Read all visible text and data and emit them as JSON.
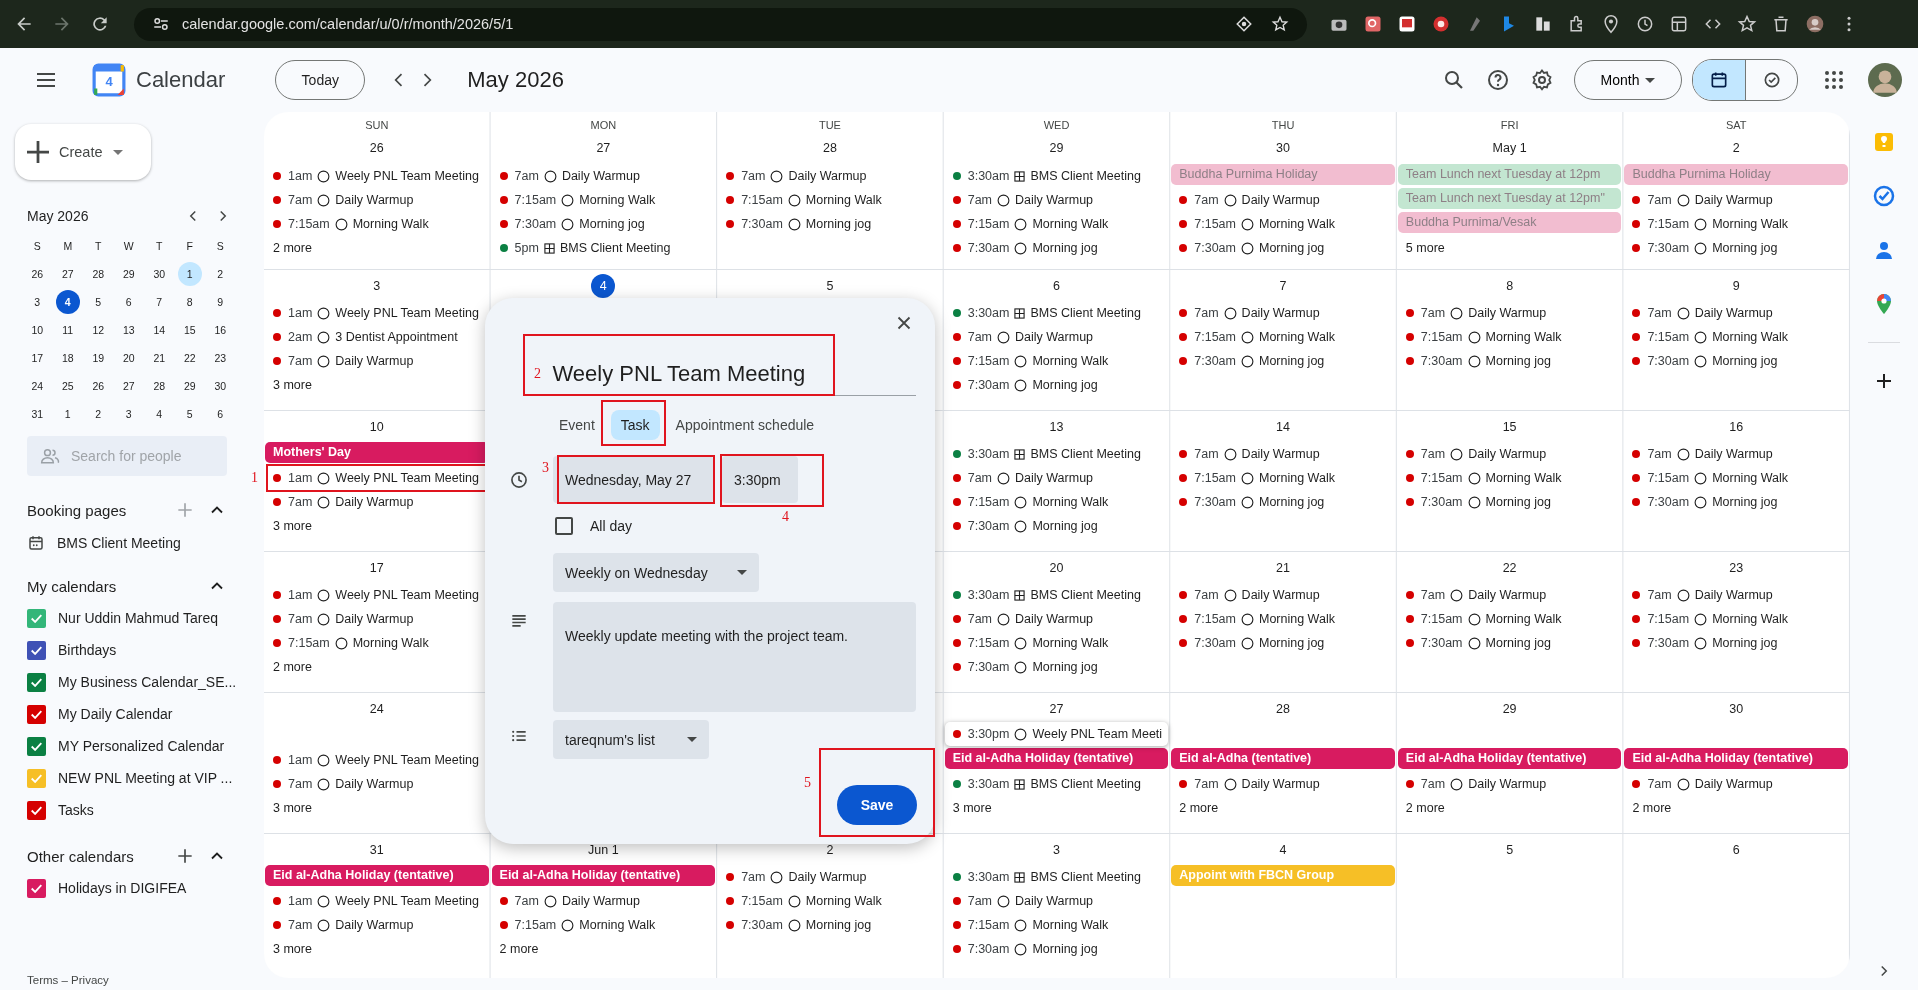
{
  "browser": {
    "url": "calendar.google.com/calendar/u/0/r/month/2026/5/1"
  },
  "header": {
    "logo_day": "4",
    "app_name": "Calendar",
    "today_button": "Today",
    "period": "May 2026",
    "view_select": "Month",
    "view_toggle": [
      {
        "kind": "calendar",
        "selected": true
      },
      {
        "kind": "tasks",
        "selected": false
      }
    ]
  },
  "sidebar": {
    "create_button": "Create",
    "mini_calendar": {
      "title": "May 2026",
      "weekdays": [
        "S",
        "M",
        "T",
        "W",
        "T",
        "F",
        "S"
      ],
      "weeks": [
        [
          {
            "d": "26",
            "selected": false
          },
          {
            "d": "27",
            "selected": false
          },
          {
            "d": "28",
            "selected": false
          },
          {
            "d": "29",
            "selected": false
          },
          {
            "d": "30",
            "selected": false
          },
          {
            "d": "1",
            "selected": true
          },
          {
            "d": "2",
            "selected": false
          }
        ],
        [
          {
            "d": "3",
            "selected": false
          },
          {
            "d": "4",
            "selected": false,
            "today": true
          },
          {
            "d": "5",
            "selected": false
          },
          {
            "d": "6",
            "selected": false
          },
          {
            "d": "7",
            "selected": false
          },
          {
            "d": "8",
            "selected": false
          },
          {
            "d": "9",
            "selected": false
          }
        ],
        [
          {
            "d": "10",
            "selected": false
          },
          {
            "d": "11",
            "selected": false
          },
          {
            "d": "12",
            "selected": false
          },
          {
            "d": "13",
            "selected": false
          },
          {
            "d": "14",
            "selected": false
          },
          {
            "d": "15",
            "selected": false
          },
          {
            "d": "16",
            "selected": false
          }
        ],
        [
          {
            "d": "17",
            "selected": false
          },
          {
            "d": "18",
            "selected": false
          },
          {
            "d": "19",
            "selected": false
          },
          {
            "d": "20",
            "selected": false
          },
          {
            "d": "21",
            "selected": false
          },
          {
            "d": "22",
            "selected": false
          },
          {
            "d": "23",
            "selected": false
          }
        ],
        [
          {
            "d": "24",
            "selected": false
          },
          {
            "d": "25",
            "selected": false
          },
          {
            "d": "26",
            "selected": false
          },
          {
            "d": "27",
            "selected": false
          },
          {
            "d": "28",
            "selected": false
          },
          {
            "d": "29",
            "selected": false
          },
          {
            "d": "30",
            "selected": false
          }
        ],
        [
          {
            "d": "31",
            "selected": false
          },
          {
            "d": "1",
            "selected": false
          },
          {
            "d": "2",
            "selected": false
          },
          {
            "d": "3",
            "selected": false
          },
          {
            "d": "4",
            "selected": false
          },
          {
            "d": "5",
            "selected": false
          },
          {
            "d": "6",
            "selected": false
          }
        ]
      ]
    },
    "search": {
      "placeholder": "Search for people"
    },
    "booking_pages": {
      "title": "Booking pages",
      "items": [
        "BMS Client Meeting"
      ]
    },
    "my_calendars": {
      "title": "My calendars",
      "items": [
        {
          "label": "Nur Uddin Mahmud Tareq",
          "checked": true,
          "color": "#33b679"
        },
        {
          "label": "Birthdays",
          "checked": true,
          "color": "#3f51b5"
        },
        {
          "label": "My Business Calendar_SE...",
          "checked": true,
          "color": "#0b8043"
        },
        {
          "label": "My Daily Calendar",
          "checked": true,
          "color": "#d50000"
        },
        {
          "label": "MY Personalized Calendar",
          "checked": true,
          "color": "#0b8043"
        },
        {
          "label": "NEW PNL Meeting at VIP ...",
          "checked": true,
          "color": "#f6bf26"
        },
        {
          "label": "Tasks",
          "checked": true,
          "color": "#d50000"
        }
      ]
    },
    "other_calendars": {
      "title": "Other calendars",
      "items": [
        {
          "label": "Holidays in DIGIFEA",
          "checked": true,
          "color": "#d81b60"
        }
      ]
    },
    "footer": "Terms – Privacy"
  },
  "month": {
    "weekdays": [
      "SUN",
      "MON",
      "TUE",
      "WED",
      "THU",
      "FRI",
      "SAT"
    ],
    "weeks": [
      {
        "days": [
          {
            "date": "26",
            "events": [
              {
                "kind": "task",
                "time": "1am",
                "title": "Weely PNL Team Meeting",
                "color": "#d50000"
              },
              {
                "kind": "task",
                "time": "7am",
                "title": "Daily Warmup",
                "color": "#d50000"
              },
              {
                "kind": "task",
                "time": "7:15am",
                "title": "Morning Walk",
                "color": "#d50000"
              }
            ],
            "more": "2 more"
          },
          {
            "date": "27",
            "events": [
              {
                "kind": "task",
                "time": "7am",
                "title": "Daily Warmup",
                "color": "#d50000"
              },
              {
                "kind": "task",
                "time": "7:15am",
                "title": "Morning Walk",
                "color": "#d50000"
              },
              {
                "kind": "task",
                "time": "7:30am",
                "title": "Morning jog",
                "color": "#d50000"
              },
              {
                "kind": "booking",
                "time": "5pm",
                "title": "BMS Client Meeting",
                "color": "#0b8043"
              }
            ]
          },
          {
            "date": "28",
            "events": [
              {
                "kind": "task",
                "time": "7am",
                "title": "Daily Warmup",
                "color": "#d50000"
              },
              {
                "kind": "task",
                "time": "7:15am",
                "title": "Morning Walk",
                "color": "#d50000"
              },
              {
                "kind": "task",
                "time": "7:30am",
                "title": "Morning jog",
                "color": "#d50000"
              }
            ]
          },
          {
            "date": "29",
            "events": [
              {
                "kind": "booking",
                "time": "3:30am",
                "title": "BMS Client Meeting",
                "color": "#0b8043"
              },
              {
                "kind": "task",
                "time": "7am",
                "title": "Daily Warmup",
                "color": "#d50000"
              },
              {
                "kind": "task",
                "time": "7:15am",
                "title": "Morning Walk",
                "color": "#d50000"
              },
              {
                "kind": "task",
                "time": "7:30am",
                "title": "Morning jog",
                "color": "#d50000"
              }
            ]
          },
          {
            "date": "30",
            "events": [
              {
                "kind": "allday",
                "title": "Buddha Purnima Holiday",
                "color": "#f2bdd0",
                "muted": true
              },
              {
                "kind": "task",
                "time": "7am",
                "title": "Daily Warmup",
                "color": "#d50000"
              },
              {
                "kind": "task",
                "time": "7:15am",
                "title": "Morning Walk",
                "color": "#d50000"
              },
              {
                "kind": "task",
                "time": "7:30am",
                "title": "Morning jog",
                "color": "#d50000"
              }
            ]
          },
          {
            "date": "May 1",
            "events": [
              {
                "kind": "allday",
                "title": "Team Lunch next Tuesday at 12pm",
                "color": "#c3e6d1",
                "muted": true
              },
              {
                "kind": "allday",
                "title": "Team Lunch next Tuesday at 12pm\"",
                "color": "#c3e6d1",
                "muted": true
              },
              {
                "kind": "allday",
                "title": "Buddha Purnima/Vesak",
                "color": "#f2bdd0",
                "muted": true
              }
            ],
            "more": "5 more"
          },
          {
            "date": "2",
            "events": [
              {
                "kind": "allday",
                "title": "Buddha Purnima Holiday",
                "color": "#f2bdd0",
                "muted": true
              },
              {
                "kind": "task",
                "time": "7am",
                "title": "Daily Warmup",
                "color": "#d50000"
              },
              {
                "kind": "task",
                "time": "7:15am",
                "title": "Morning Walk",
                "color": "#d50000"
              },
              {
                "kind": "task",
                "time": "7:30am",
                "title": "Morning jog",
                "color": "#d50000"
              }
            ]
          }
        ]
      },
      {
        "days": [
          {
            "date": "3",
            "events": [
              {
                "kind": "task",
                "time": "1am",
                "title": "Weely PNL Team Meeting",
                "color": "#d50000"
              },
              {
                "kind": "task",
                "time": "2am",
                "title": "3 Dentist Appointment",
                "color": "#d50000"
              },
              {
                "kind": "task",
                "time": "7am",
                "title": "Daily Warmup",
                "color": "#d50000"
              }
            ],
            "more": "3 more"
          },
          {
            "date": "4",
            "today": true
          },
          {
            "date": "5"
          },
          {
            "date": "6",
            "events": [
              {
                "kind": "booking",
                "time": "3:30am",
                "title": "BMS Client Meeting",
                "color": "#0b8043"
              },
              {
                "kind": "task",
                "time": "7am",
                "title": "Daily Warmup",
                "color": "#d50000"
              },
              {
                "kind": "task",
                "time": "7:15am",
                "title": "Morning Walk",
                "color": "#d50000"
              },
              {
                "kind": "task",
                "time": "7:30am",
                "title": "Morning jog",
                "color": "#d50000"
              }
            ]
          },
          {
            "date": "7",
            "events": [
              {
                "kind": "task",
                "time": "7am",
                "title": "Daily Warmup",
                "color": "#d50000"
              },
              {
                "kind": "task",
                "time": "7:15am",
                "title": "Morning Walk",
                "color": "#d50000"
              },
              {
                "kind": "task",
                "time": "7:30am",
                "title": "Morning jog",
                "color": "#d50000"
              }
            ]
          },
          {
            "date": "8",
            "events": [
              {
                "kind": "task",
                "time": "7am",
                "title": "Daily Warmup",
                "color": "#d50000"
              },
              {
                "kind": "task",
                "time": "7:15am",
                "title": "Morning Walk",
                "color": "#d50000"
              },
              {
                "kind": "task",
                "time": "7:30am",
                "title": "Morning jog",
                "color": "#d50000"
              }
            ]
          },
          {
            "date": "9",
            "events": [
              {
                "kind": "task",
                "time": "7am",
                "title": "Daily Warmup",
                "color": "#d50000"
              },
              {
                "kind": "task",
                "time": "7:15am",
                "title": "Morning Walk",
                "color": "#d50000"
              },
              {
                "kind": "task",
                "time": "7:30am",
                "title": "Morning jog",
                "color": "#d50000"
              }
            ]
          }
        ]
      },
      {
        "days": [
          {
            "date": "10",
            "events": [
              {
                "kind": "allday",
                "title": "Mothers' Day",
                "color": "#d81b60",
                "muted": false
              },
              {
                "kind": "task",
                "time": "1am",
                "title": "Weely PNL Team Meeting",
                "color": "#d50000",
                "highlighted": true,
                "callout_number": "1"
              },
              {
                "kind": "task",
                "time": "7am",
                "title": "Daily Warmup",
                "color": "#d50000"
              }
            ],
            "more": "3 more"
          },
          {
            "date": "13",
            "events": [
              {
                "kind": "booking",
                "time": "3:30am",
                "title": "BMS Client Meeting",
                "color": "#0b8043"
              },
              {
                "kind": "task",
                "time": "7am",
                "title": "Daily Warmup",
                "color": "#d50000"
              },
              {
                "kind": "task",
                "time": "7:15am",
                "title": "Morning Walk",
                "color": "#d50000"
              },
              {
                "kind": "task",
                "time": "7:30am",
                "title": "Morning jog",
                "color": "#d50000"
              }
            ]
          },
          {
            "date": "14",
            "events": [
              {
                "kind": "task",
                "time": "7am",
                "title": "Daily Warmup",
                "color": "#d50000"
              },
              {
                "kind": "task",
                "time": "7:15am",
                "title": "Morning Walk",
                "color": "#d50000"
              },
              {
                "kind": "task",
                "time": "7:30am",
                "title": "Morning jog",
                "color": "#d50000"
              }
            ]
          },
          {
            "date": "15",
            "events": [
              {
                "kind": "task",
                "time": "7am",
                "title": "Daily Warmup",
                "color": "#d50000"
              },
              {
                "kind": "task",
                "time": "7:15am",
                "title": "Morning Walk",
                "color": "#d50000"
              },
              {
                "kind": "task",
                "time": "7:30am",
                "title": "Morning jog",
                "color": "#d50000"
              }
            ]
          },
          {
            "date": "16",
            "events": [
              {
                "kind": "task",
                "time": "7am",
                "title": "Daily Warmup",
                "color": "#d50000"
              },
              {
                "kind": "task",
                "time": "7:15am",
                "title": "Morning Walk",
                "color": "#d50000"
              },
              {
                "kind": "task",
                "time": "7:30am",
                "title": "Morning jog",
                "color": "#d50000"
              }
            ]
          }
        ]
      },
      {
        "days": [
          {
            "date": "17",
            "events": [
              {
                "kind": "task",
                "time": "1am",
                "title": "Weely PNL Team Meeting",
                "color": "#d50000"
              },
              {
                "kind": "task",
                "time": "7am",
                "title": "Daily Warmup",
                "color": "#d50000"
              },
              {
                "kind": "task",
                "time": "7:15am",
                "title": "Morning Walk",
                "color": "#d50000"
              }
            ],
            "more": "2 more"
          },
          {
            "date": "20",
            "events": [
              {
                "kind": "booking",
                "time": "3:30am",
                "title": "BMS Client Meeting",
                "color": "#0b8043"
              },
              {
                "kind": "task",
                "time": "7am",
                "title": "Daily Warmup",
                "color": "#d50000"
              },
              {
                "kind": "task",
                "time": "7:15am",
                "title": "Morning Walk",
                "color": "#d50000"
              },
              {
                "kind": "task",
                "time": "7:30am",
                "title": "Morning jog",
                "color": "#d50000"
              }
            ]
          },
          {
            "date": "21",
            "events": [
              {
                "kind": "task",
                "time": "7am",
                "title": "Daily Warmup",
                "color": "#d50000"
              },
              {
                "kind": "task",
                "time": "7:15am",
                "title": "Morning Walk",
                "color": "#d50000"
              },
              {
                "kind": "task",
                "time": "7:30am",
                "title": "Morning jog",
                "color": "#d50000"
              }
            ]
          },
          {
            "date": "22",
            "events": [
              {
                "kind": "task",
                "time": "7am",
                "title": "Daily Warmup",
                "color": "#d50000"
              },
              {
                "kind": "task",
                "time": "7:15am",
                "title": "Morning Walk",
                "color": "#d50000"
              },
              {
                "kind": "task",
                "time": "7:30am",
                "title": "Morning jog",
                "color": "#d50000"
              }
            ]
          },
          {
            "date": "23",
            "events": [
              {
                "kind": "task",
                "time": "7am",
                "title": "Daily Warmup",
                "color": "#d50000"
              },
              {
                "kind": "task",
                "time": "7:15am",
                "title": "Morning Walk",
                "color": "#d50000"
              },
              {
                "kind": "task",
                "time": "7:30am",
                "title": "Morning jog",
                "color": "#d50000"
              }
            ]
          }
        ]
      },
      {
        "days": [
          {
            "date": "24",
            "events": [
              {
                "kind": "task",
                "time": "1am",
                "title": "Weely PNL Team Meeting",
                "color": "#d50000"
              },
              {
                "kind": "task",
                "time": "7am",
                "title": "Daily Warmup",
                "color": "#d50000"
              }
            ],
            "more": "3 more"
          },
          {
            "date": "27",
            "events": [
              {
                "kind": "floating",
                "time": "3:30pm",
                "title": "Weely PNL Team Meeti",
                "color": "#d50000"
              },
              {
                "kind": "allday",
                "title": "Eid al-Adha Holiday (tentative)",
                "color": "#d81b60",
                "muted": false
              },
              {
                "kind": "booking",
                "time": "3:30am",
                "title": "BMS Client Meeting",
                "color": "#0b8043"
              }
            ],
            "more": "3 more"
          },
          {
            "date": "28",
            "events": [
              {
                "kind": "allday",
                "title": "Eid al-Adha (tentative)",
                "color": "#d81b60",
                "muted": false
              },
              {
                "kind": "task",
                "time": "7am",
                "title": "Daily Warmup",
                "color": "#d50000"
              }
            ],
            "more": "2 more"
          },
          {
            "date": "29",
            "events": [
              {
                "kind": "allday",
                "title": "Eid al-Adha Holiday (tentative)",
                "color": "#d81b60",
                "muted": false
              },
              {
                "kind": "task",
                "time": "7am",
                "title": "Daily Warmup",
                "color": "#d50000"
              }
            ],
            "more": "2 more"
          },
          {
            "date": "30",
            "events": [
              {
                "kind": "allday",
                "title": "Eid al-Adha Holiday (tentative)",
                "color": "#d81b60",
                "muted": false
              },
              {
                "kind": "task",
                "time": "7am",
                "title": "Daily Warmup",
                "color": "#d50000"
              }
            ],
            "more": "2 more"
          }
        ]
      },
      {
        "days": [
          {
            "date": "31",
            "events": [
              {
                "kind": "allday",
                "title": "Eid al-Adha Holiday (tentative)",
                "color": "#d81b60",
                "muted": false
              },
              {
                "kind": "task",
                "time": "1am",
                "title": "Weely PNL Team Meeting",
                "color": "#d50000"
              },
              {
                "kind": "task",
                "time": "7am",
                "title": "Daily Warmup",
                "color": "#d50000"
              }
            ],
            "more": "3 more"
          },
          {
            "date": "Jun 1",
            "events": [
              {
                "kind": "allday",
                "title": "Eid al-Adha Holiday (tentative)",
                "color": "#d81b60",
                "muted": false
              },
              {
                "kind": "task",
                "time": "7am",
                "title": "Daily Warmup",
                "color": "#d50000"
              },
              {
                "kind": "task",
                "time": "7:15am",
                "title": "Morning Walk",
                "color": "#d50000"
              }
            ],
            "more": "2 more"
          },
          {
            "date": "2",
            "events": [
              {
                "kind": "task",
                "time": "7am",
                "title": "Daily Warmup",
                "color": "#d50000"
              },
              {
                "kind": "task",
                "time": "7:15am",
                "title": "Morning Walk",
                "color": "#d50000"
              },
              {
                "kind": "task",
                "time": "7:30am",
                "title": "Morning jog",
                "color": "#d50000"
              }
            ]
          },
          {
            "date": "3",
            "events": [
              {
                "kind": "booking",
                "time": "3:30am",
                "title": "BMS Client Meeting",
                "color": "#0b8043"
              },
              {
                "kind": "task",
                "time": "7am",
                "title": "Daily Warmup",
                "color": "#d50000"
              },
              {
                "kind": "task",
                "time": "7:15am",
                "title": "Morning Walk",
                "color": "#d50000"
              },
              {
                "kind": "task",
                "time": "7:30am",
                "title": "Morning jog",
                "color": "#d50000"
              }
            ]
          },
          {
            "date": "4",
            "events": [
              {
                "kind": "allday",
                "title": "Appoint with FBCN Group",
                "color": "#f6bf26",
                "muted": false
              }
            ]
          },
          {
            "date": "5"
          },
          {
            "date": "6"
          }
        ]
      }
    ]
  },
  "dialog": {
    "title": {
      "value": "Weely PNL Team Meeting",
      "highlighted": true,
      "callout_number": "2"
    },
    "tabs": [
      {
        "label": "Event",
        "selected": false,
        "highlighted": false
      },
      {
        "label": "Task",
        "selected": true,
        "highlighted": true
      },
      {
        "label": "Appointment schedule",
        "selected": false,
        "highlighted": false
      }
    ],
    "date": {
      "value": "Wednesday, May 27",
      "highlighted": true,
      "callout_number": "3"
    },
    "time": {
      "value": "3:30pm",
      "highlighted": true,
      "callout_number": "4"
    },
    "all_day": {
      "label": "All day",
      "checked": false
    },
    "repeat": "Weekly on Wednesday",
    "description": "Weekly update meeting with the project team.",
    "list": "tareqnum's list",
    "save": {
      "label": "Save",
      "highlighted": true,
      "callout_number": "5"
    }
  }
}
